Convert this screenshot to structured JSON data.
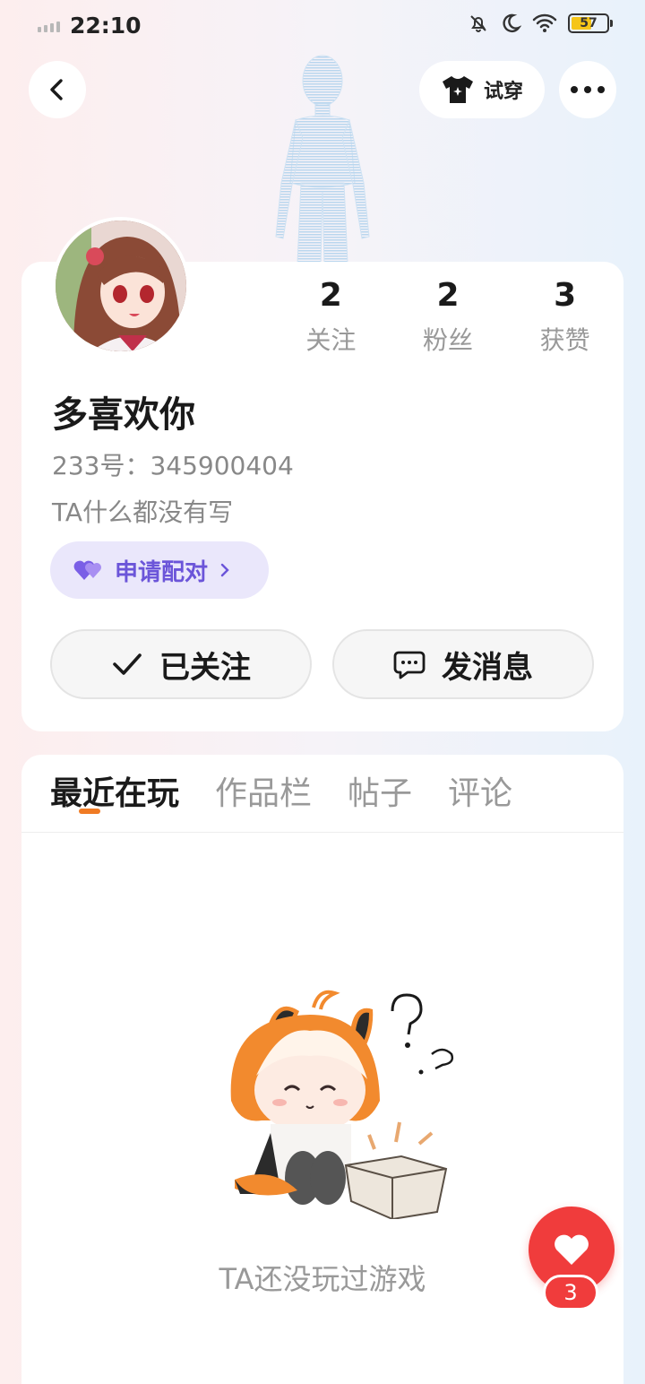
{
  "status_bar": {
    "time": "22:10",
    "battery": "57"
  },
  "header": {
    "tryon_label": "试穿"
  },
  "profile": {
    "stats": [
      {
        "value": "2",
        "label": "关注"
      },
      {
        "value": "2",
        "label": "粉丝"
      },
      {
        "value": "3",
        "label": "获赞"
      }
    ],
    "username": "多喜欢你",
    "user_id": "233号：345900404",
    "bio": "TA什么都没有写",
    "pair_label": "申请配对",
    "follow_label": "已关注",
    "message_label": "发消息"
  },
  "tabs": [
    {
      "label": "最近在玩"
    },
    {
      "label": "作品栏"
    },
    {
      "label": "帖子"
    },
    {
      "label": "评论"
    }
  ],
  "empty_state": {
    "text": "TA还没玩过游戏"
  },
  "like": {
    "count": "3"
  },
  "colors": {
    "accent_orange": "#f07b24",
    "pair_purple": "#6b55d9",
    "like_red": "#f03c3c"
  }
}
